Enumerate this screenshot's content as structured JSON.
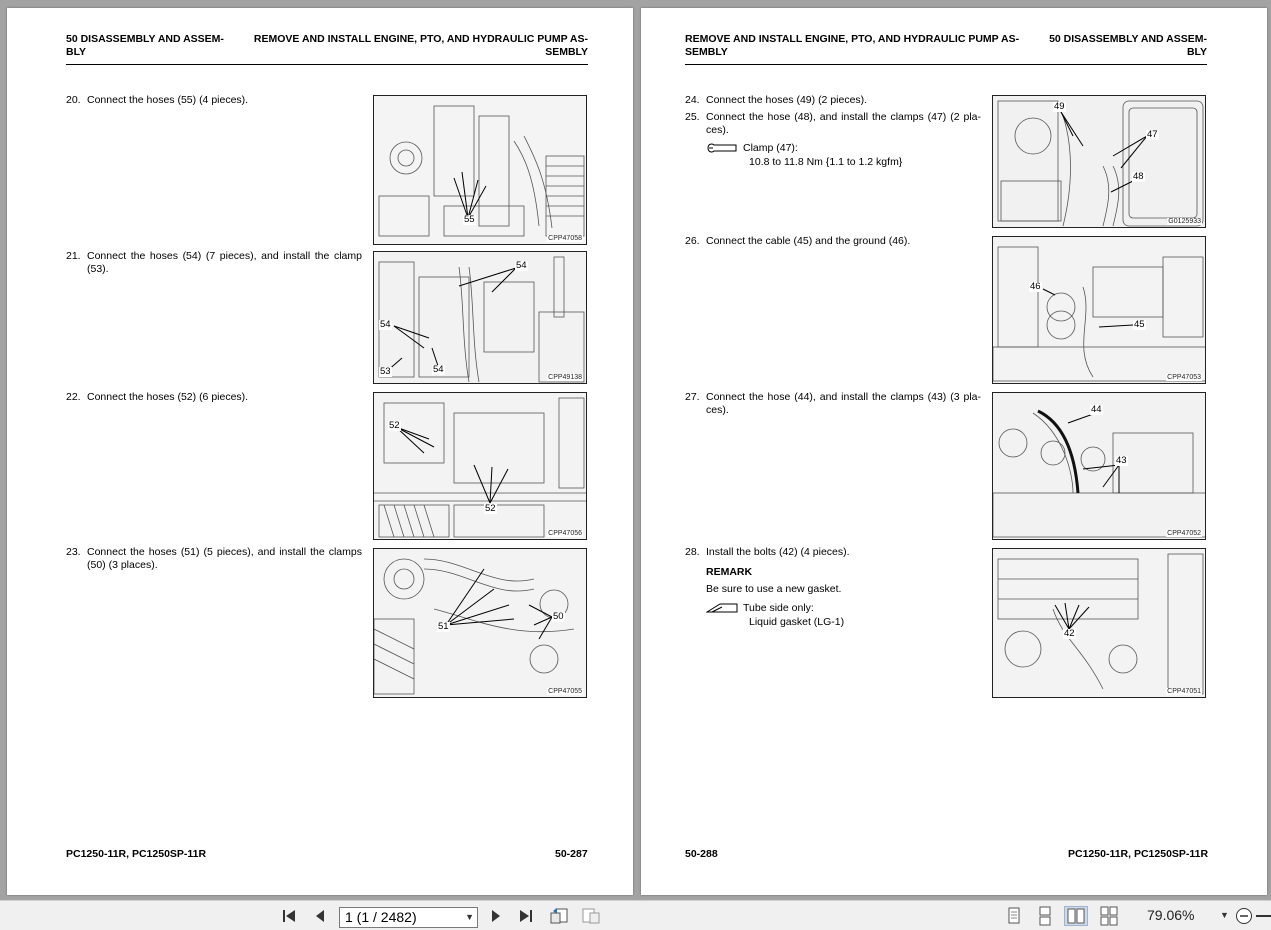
{
  "left_page": {
    "header_left": "50 DISASSEMBLY AND ASSEM-\nBLY",
    "header_right": "REMOVE AND INSTALL ENGINE, PTO, AND HYDRAULIC PUMP AS-\nSEMBLY",
    "footer_model": "PC1250-11R, PC1250SP-11R",
    "footer_page": "50-287",
    "steps": [
      {
        "num": "20.",
        "text": "Connect the hoses (55) (4 pieces).",
        "fig_code": "CPP47058",
        "callouts": [
          "55"
        ]
      },
      {
        "num": "21.",
        "text": "Connect the hoses (54) (7 pieces), and install the clamp (53).",
        "fig_code": "CPP49138",
        "callouts": [
          "54",
          "54",
          "53",
          "54"
        ]
      },
      {
        "num": "22.",
        "text": "Connect the hoses (52) (6 pieces).",
        "fig_code": "CPP47056",
        "callouts": [
          "52",
          "52"
        ]
      },
      {
        "num": "23.",
        "text": "Connect the hoses (51) (5 pieces), and install the clamps (50) (3 places).",
        "fig_code": "CPP47055",
        "callouts": [
          "51",
          "50"
        ]
      }
    ]
  },
  "right_page": {
    "header_left": "REMOVE AND INSTALL ENGINE, PTO, AND HYDRAULIC PUMP AS-\nSEMBLY",
    "header_right": "50 DISASSEMBLY AND ASSEM-\nBLY",
    "footer_page": "50-288",
    "footer_model": "PC1250-11R, PC1250SP-11R",
    "steps": [
      {
        "num": "24.",
        "text": "Connect the hoses (49) (2 pieces).",
        "fig_code": "G0125933",
        "callouts": [
          "49",
          "47",
          "48"
        ]
      },
      {
        "num": "25.",
        "text": "Connect the hose (48), and install the clamps (47) (2 pla-ces)."
      },
      {
        "num": "26.",
        "text": "Connect the cable (45) and the ground (46).",
        "fig_code": "CPP47053",
        "callouts": [
          "46",
          "45"
        ]
      },
      {
        "num": "27.",
        "text": "Connect the hose (44), and install the clamps (43) (3 pla-ces).",
        "fig_code": "CPP47052",
        "callouts": [
          "44",
          "43"
        ]
      },
      {
        "num": "28.",
        "text": "Install the bolts (42) (4 pieces).",
        "fig_code": "CPP47051",
        "callouts": [
          "42"
        ]
      }
    ],
    "torque_label": "Clamp (47):",
    "torque_value": "10.8 to 11.8 Nm {1.1 to 1.2 kgfm}",
    "remark_title": "REMARK",
    "remark_text": "Be sure to use a new gasket.",
    "gasket_label": "Tube side only:",
    "gasket_value": "Liquid gasket (LG-1)"
  },
  "toolbar": {
    "page_indicator": "1 (1 / 2482)",
    "zoom": "79.06%",
    "icons": [
      "first-page-icon",
      "prev-page-icon",
      "next-page-icon",
      "last-page-icon",
      "prev-view-icon",
      "next-view-icon",
      "single-page-icon",
      "continuous-icon",
      "facing-icon",
      "continuous-facing-icon",
      "zoom-out-icon"
    ]
  }
}
